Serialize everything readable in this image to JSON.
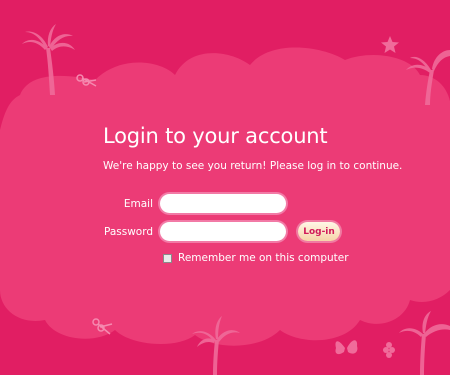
{
  "login": {
    "title": "Login to your account",
    "subtitle": "We're happy to see you return! Please log in to continue.",
    "email_label": "Email",
    "email_value": "",
    "password_label": "Password",
    "password_value": "",
    "button_label": "Log-in",
    "remember_label": "Remember me on this computer",
    "remember_checked": false
  },
  "colors": {
    "background": "#e11e63",
    "blob": "#ec3b76",
    "button_text": "#d11b5a"
  },
  "decorations": [
    "palm-tree-icon",
    "scissors-icon",
    "star-icon",
    "butterfly-icon",
    "flower-icon"
  ]
}
